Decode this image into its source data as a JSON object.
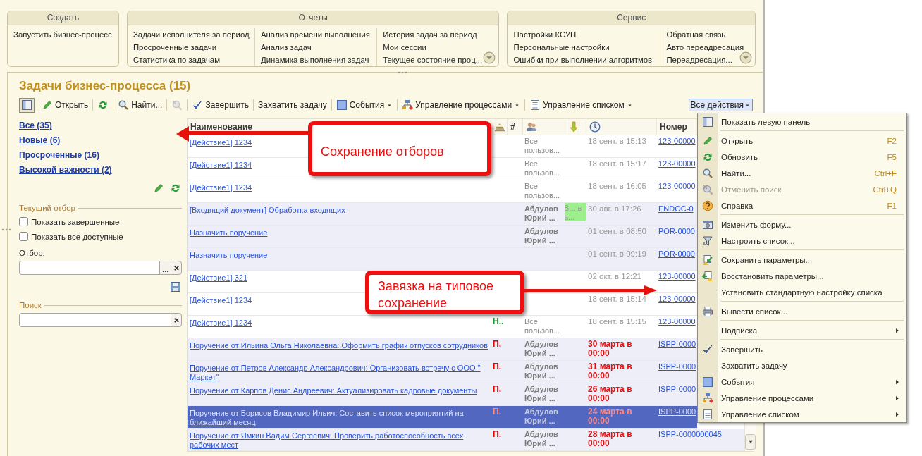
{
  "top_panels": [
    {
      "title": "Создать",
      "columns": [
        [
          "Запустить бизнес-процесс"
        ]
      ],
      "expand_button": false
    },
    {
      "title": "Отчеты",
      "columns": [
        [
          "Задачи исполнителя за период",
          "Просроченные задачи",
          "Статистика по задачам"
        ],
        [
          "Анализ времени выполнения",
          "Анализ задач",
          "Динамика выполнения задач"
        ],
        [
          "История задач за период",
          "Мои сессии",
          "Текущее состояние проц..."
        ]
      ],
      "expand_button": true
    },
    {
      "title": "Сервис",
      "columns": [
        [
          "Настройки КСУП",
          "Персональные настройки",
          "Ошибки при выполнении алгоритмов"
        ],
        [
          "Обратная связь",
          "Авто переадресация",
          "Переадресация..."
        ]
      ],
      "expand_button": true
    }
  ],
  "form": {
    "title": "Задачи бизнес-процесса (15)",
    "toolbar": [
      {
        "kind": "panel"
      },
      {
        "kind": "open",
        "label": "Открыть"
      },
      {
        "kind": "refresh"
      },
      {
        "kind": "find",
        "label": "Найти..."
      },
      {
        "kind": "cancel",
        "disabled": true
      },
      {
        "kind": "complete",
        "label": "Завершить"
      },
      {
        "kind": "plain",
        "label": "Захватить задачу"
      },
      {
        "kind": "events",
        "label": "События",
        "dropdown": true
      },
      {
        "kind": "process",
        "label": "Управление процессами",
        "dropdown": true
      },
      {
        "kind": "list",
        "label": "Управление списком",
        "dropdown": true
      }
    ],
    "all_actions": {
      "label": "Все действия",
      "pressed": true
    },
    "left_panel": {
      "filters": [
        "Все (35)",
        "Новые (6)",
        "Просроченные (16)",
        "Высокой важности (2)"
      ],
      "current_filter": {
        "title": "Текущий отбор",
        "checkboxes": [
          {
            "label": "Показать завершенные",
            "checked": false
          },
          {
            "label": "Показать все доступные",
            "checked": false
          }
        ],
        "field_label": "Отбор:"
      },
      "search": {
        "title": "Поиск"
      }
    },
    "table": {
      "columns": [
        {
          "kind": "text",
          "label": "Наименование"
        },
        {
          "kind": "priority"
        },
        {
          "kind": "text",
          "label": "#"
        },
        {
          "kind": "users"
        },
        {
          "kind": "flag"
        },
        {
          "kind": "clock"
        },
        {
          "kind": "text",
          "label": "Номер"
        }
      ],
      "rows": [
        {
          "name": "[Действие1] 1234",
          "user": "Все пользов...",
          "date": "18 сент. в 15:13",
          "overdue": false,
          "number": "123-00000",
          "bold": false,
          "selected": false
        },
        {
          "name": "[Действие1] 1234",
          "user": "Все пользов...",
          "date": "18 сент. в 15:17",
          "overdue": false,
          "number": "123-00000",
          "bold": false,
          "selected": false
        },
        {
          "name": "[Действие1] 1234",
          "user": "Все пользов...",
          "date": "18 сент. в 16:05",
          "overdue": false,
          "number": "123-00000",
          "bold": false,
          "selected": false
        },
        {
          "name": "[Входящий документ] Обработка входящих",
          "user": "Абдулов Юрий ...",
          "status": {
            "text": "В... ва...",
            "color": "#9cef8c"
          },
          "date": "30 авг. в 17:26",
          "overdue": false,
          "number": "ENDOC-0",
          "bold": true,
          "selected": false
        },
        {
          "name": "Назначить поручение",
          "user": "Абдулов Юрий ...",
          "date": "01 сент. в 08:50",
          "overdue": false,
          "number": "POR-0000",
          "bold": true,
          "selected": false
        },
        {
          "name": "Назначить поручение",
          "date": "01 сент. в 09:19",
          "overdue": false,
          "number": "POR-0000",
          "bold": true,
          "selected": false
        },
        {
          "name": "[Действие1] 321",
          "date": "02 окт. в 12:21",
          "overdue": false,
          "number": "123-00000",
          "bold": false,
          "selected": false
        },
        {
          "name": "[Действие1] 1234",
          "date": "18 сент. в 15:14",
          "overdue": false,
          "number": "123-00000",
          "bold": false,
          "selected": false
        },
        {
          "name": "[Действие1] 1234",
          "importance": {
            "text": "Н..",
            "color": "#1a9a2a"
          },
          "user": "Все пользов...",
          "date": "18 сент. в 15:15",
          "overdue": false,
          "number": "123-00000",
          "bold": false,
          "selected": false
        },
        {
          "name": "Поручение от Ильина Ольга Николаевна: Оформить график отпусков сотрудников",
          "importance": {
            "text": "П.",
            "color": "#e00000"
          },
          "user": "Абдулов Юрий ...",
          "date": "30 марта в 00:00",
          "overdue": true,
          "number": "ISPP-0000",
          "bold": true,
          "selected": false
        },
        {
          "name": "Поручение от Петров Александр Александрович: Организовать встречу с ООО \" Маркет\"",
          "importance": {
            "text": "П.",
            "color": "#e00000"
          },
          "user": "Абдулов Юрий ...",
          "date": "31 марта в 00:00",
          "overdue": true,
          "number": "ISPP-0000",
          "bold": true,
          "selected": false
        },
        {
          "name": "Поручение от Карпов Денис Андреевич: Актуализировать кадровые документы",
          "importance": {
            "text": "П.",
            "color": "#e00000"
          },
          "user": "Абдулов Юрий ...",
          "date": "26 марта в 00:00",
          "overdue": true,
          "number": "ISPP-0000",
          "bold": true,
          "selected": false
        },
        {
          "name": "Поручение от Борисов Владимир Ильич: Составить список мероприятий на ближайший месяц",
          "importance": {
            "text": "П.",
            "color": "#ff8a8a"
          },
          "user": "Абдулов Юрий ...",
          "date": "24 марта в 00:00",
          "overdue": true,
          "number": "ISPP-0000",
          "bold": true,
          "selected": true
        },
        {
          "name": "Поручение от Ямкин Вадим Сергеевич: Проверить работоспособность всех рабочих мест",
          "importance": {
            "text": "П.",
            "color": "#e00000"
          },
          "user": "Абдулов Юрий ...",
          "date": "28 марта в 00:00",
          "overdue": true,
          "number": "ISPP-0000000045",
          "bold": true,
          "selected": false
        }
      ]
    }
  },
  "menu": {
    "groups": [
      [
        {
          "kind": "panel",
          "label": "Показать левую панель"
        }
      ],
      [
        {
          "kind": "open",
          "label": "Открыть",
          "shortcut": "F2"
        },
        {
          "kind": "refresh",
          "label": "Обновить",
          "shortcut": "F5"
        },
        {
          "kind": "find",
          "label": "Найти...",
          "shortcut": "Ctrl+F"
        },
        {
          "kind": "cancel",
          "label": "Отменить поиск",
          "shortcut": "Ctrl+Q",
          "disabled": true
        },
        {
          "kind": "help",
          "label": "Справка",
          "shortcut": "F1"
        }
      ],
      [
        {
          "kind": "form",
          "label": "Изменить форму..."
        },
        {
          "kind": "filter",
          "label": "Настроить список..."
        }
      ],
      [
        {
          "kind": "save",
          "label": "Сохранить параметры..."
        },
        {
          "kind": "restore",
          "label": "Восстановить параметры..."
        },
        {
          "kind": "plain",
          "label": "Установить стандартную настройку списка"
        }
      ],
      [
        {
          "kind": "print",
          "label": "Вывести список..."
        }
      ],
      [
        {
          "kind": "plain",
          "label": "Подписка",
          "submenu": true
        }
      ],
      [
        {
          "kind": "complete",
          "label": "Завершить"
        },
        {
          "kind": "plain",
          "label": "Захватить задачу"
        },
        {
          "kind": "events",
          "label": "События",
          "submenu": true
        },
        {
          "kind": "process",
          "label": "Управление процессами",
          "submenu": true
        },
        {
          "kind": "list",
          "label": "Управление списком",
          "submenu": true
        }
      ]
    ]
  },
  "annotations": [
    "Сохранение отборов",
    "Завязка на типовое сохранение"
  ]
}
